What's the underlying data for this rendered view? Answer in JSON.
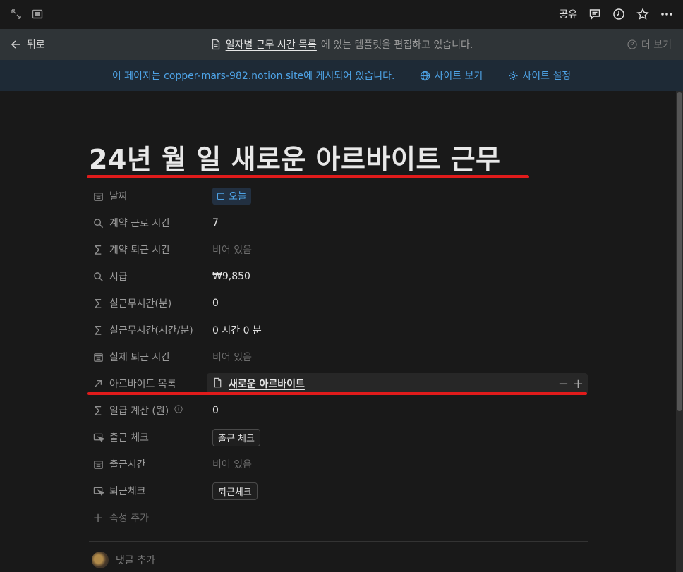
{
  "topbar": {
    "expand_icon": "expand-icon",
    "sidebar_icon": "sidebar-icon",
    "share_label": "공유",
    "comment_icon": "comment-icon",
    "history_icon": "clock-icon",
    "favorite_icon": "star-icon",
    "more_icon": "more-icon"
  },
  "template_bar": {
    "back_label": "뒤로",
    "page_name": "일자별 근무 시간 목록",
    "message": "에 있는 템플릿을 편집하고 있습니다.",
    "more_label": "더 보기"
  },
  "publish_bar": {
    "message": "이 페이지는 copper-mars-982.notion.site에 게시되어 있습니다.",
    "view_site": "사이트 보기",
    "site_settings": "사이트 설정"
  },
  "page": {
    "title": "24년 월 일 새로운 아르바이트 근무",
    "properties": [
      {
        "name": "날짜",
        "icon": "calendar-icon",
        "value": "오늘",
        "kind": "date"
      },
      {
        "name": "계약 근로 시간",
        "icon": "search-icon",
        "value": "7",
        "kind": "text"
      },
      {
        "name": "계약 퇴근 시간",
        "icon": "sigma-icon",
        "value": "비어 있음",
        "kind": "empty"
      },
      {
        "name": "시급",
        "icon": "search-icon",
        "value": "₩9,850",
        "kind": "text"
      },
      {
        "name": "실근무시간(분)",
        "icon": "sigma-icon",
        "value": "0",
        "kind": "text"
      },
      {
        "name": "실근무시간(시간/분)",
        "icon": "sigma-icon",
        "value": "0 시간 0 분",
        "kind": "text"
      },
      {
        "name": "실제 퇴근 시간",
        "icon": "calendar-icon",
        "value": "비어 있음",
        "kind": "empty"
      },
      {
        "name": "아르바이트 목록",
        "icon": "arrow-icon",
        "value": "새로운 아르바이트",
        "kind": "relation"
      },
      {
        "name": "일급 계산 (원)",
        "icon": "sigma-icon",
        "value": "0",
        "kind": "text"
      },
      {
        "name": "출근 체크",
        "icon": "cursor-icon",
        "value": "출근 체크",
        "kind": "button"
      },
      {
        "name": "출근시간",
        "icon": "calendar-icon",
        "value": "비어 있음",
        "kind": "empty"
      },
      {
        "name": "퇴근체크",
        "icon": "cursor-icon",
        "value": "퇴근체크",
        "kind": "button"
      }
    ],
    "add_property": "속성 추가",
    "add_comment": "댓글 추가"
  },
  "colors": {
    "accent_blue": "#4ea3e6",
    "annotation_red": "#e01b1b"
  }
}
